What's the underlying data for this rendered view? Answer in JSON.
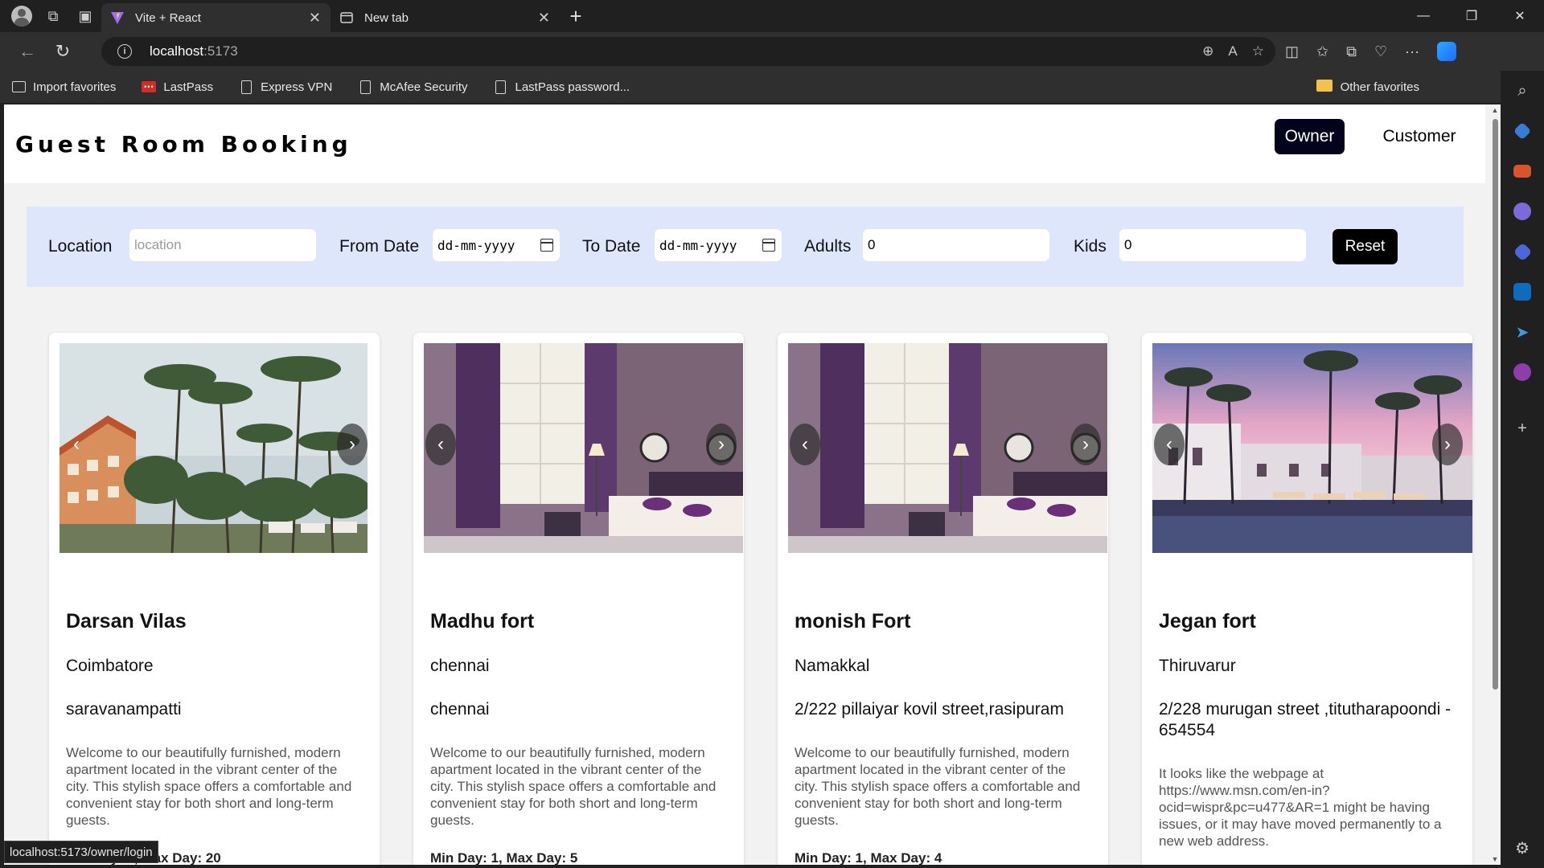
{
  "browser": {
    "tabs": [
      {
        "title": "Vite + React",
        "active": true
      },
      {
        "title": "New tab",
        "active": false
      }
    ],
    "url_host": "localhost",
    "url_port": ":5173",
    "favorites": [
      "Import favorites",
      "LastPass",
      "Express VPN",
      "McAfee Security",
      "LastPass password..."
    ],
    "other_favorites": "Other favorites",
    "status_url": "localhost:5173/owner/login"
  },
  "header": {
    "brand": "Guest Room Booking",
    "owner_label": "Owner",
    "customer_label": "Customer"
  },
  "filters": {
    "location_label": "Location",
    "location_placeholder": "location",
    "from_label": "From Date",
    "from_value": "dd-mm-yyyy",
    "to_label": "To Date",
    "to_value": "dd-mm-yyyy",
    "adults_label": "Adults",
    "adults_value": "0",
    "kids_label": "Kids",
    "kids_value": "0",
    "reset_label": "Reset"
  },
  "cards": [
    {
      "name": "Darsan Vilas",
      "city": "Coimbatore",
      "address": "saravanampatti",
      "description": "Welcome to our beautifully furnished, modern apartment located in the vibrant center of the city. This stylish space offers a comfortable and convenient stay for both short and long-term guests.",
      "days": "Min Day: 1, Max Day: 20",
      "image": "palm-resort"
    },
    {
      "name": "Madhu fort",
      "city": "chennai",
      "address": "chennai",
      "description": "Welcome to our beautifully furnished, modern apartment located in the vibrant center of the city. This stylish space offers a comfortable and convenient stay for both short and long-term guests.",
      "days": "Min Day: 1, Max Day: 5",
      "image": "purple-bedroom"
    },
    {
      "name": "monish Fort",
      "city": "Namakkal",
      "address": "2/222 pillaiyar kovil street,rasipuram",
      "description": "Welcome to our beautifully furnished, modern apartment located in the vibrant center of the city. This stylish space offers a comfortable and convenient stay for both short and long-term guests.",
      "days": "Min Day: 1, Max Day: 4",
      "image": "purple-bedroom"
    },
    {
      "name": "Jegan fort",
      "city": "Thiruvarur",
      "address": "2/228 murugan street ,titutharapoondi - 654554",
      "description": "It looks like the webpage at https://www.msn.com/en-in?ocid=wispr&pc=u477&AR=1 might be having issues, or it may have moved permanently to a new web address.",
      "days": "",
      "image": "pool-sunset"
    }
  ]
}
